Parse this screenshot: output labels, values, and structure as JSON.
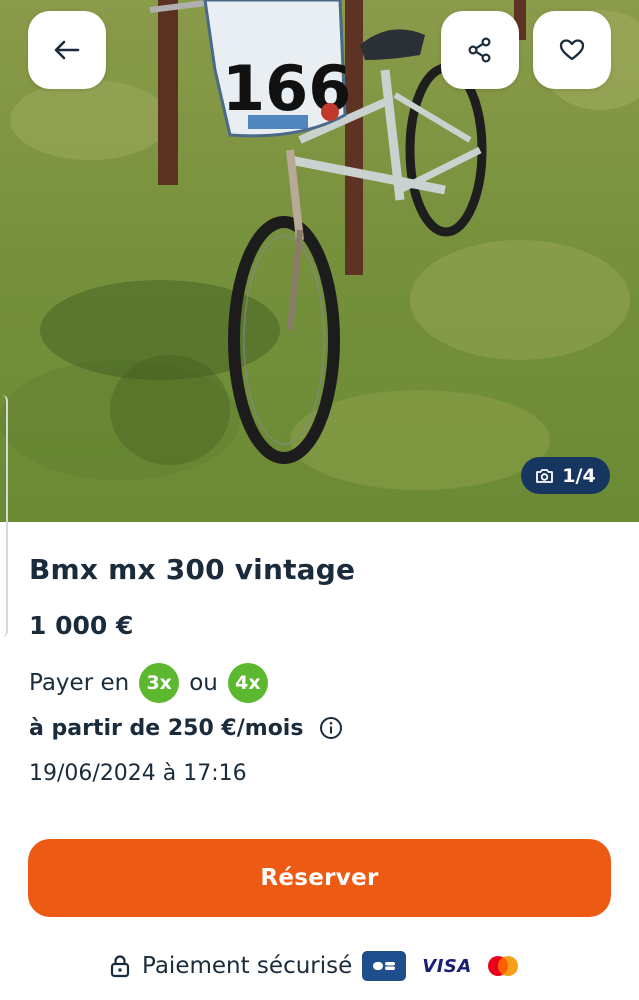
{
  "photo": {
    "description_icon": "bmx-bike-photo",
    "plate_number": "166"
  },
  "header": {
    "back_icon": "arrow-left-icon",
    "share_icon": "share-icon",
    "favorite_icon": "heart-icon"
  },
  "gallery": {
    "counter": "1/4",
    "counter_icon": "camera-icon"
  },
  "listing": {
    "title": "Bmx mx 300 vintage",
    "price": "1 000 €",
    "installments": {
      "prefix": "Payer en",
      "option_1": "3x",
      "separator": "ou",
      "option_2": "4x",
      "from_text": "à partir de 250 €/mois",
      "info_icon": "info-icon"
    },
    "date": "19/06/2024 à 17:16"
  },
  "actions": {
    "reserve_label": "Réserver"
  },
  "footer": {
    "secure_label": "Paiement sécurisé",
    "lock_icon": "lock-icon",
    "cards": [
      "CB",
      "VISA",
      "mastercard"
    ]
  },
  "colors": {
    "accent": "#ec5a13",
    "installment_green": "#5cb82e",
    "counter_bg": "#17365f",
    "text": "#1a2b3c"
  }
}
